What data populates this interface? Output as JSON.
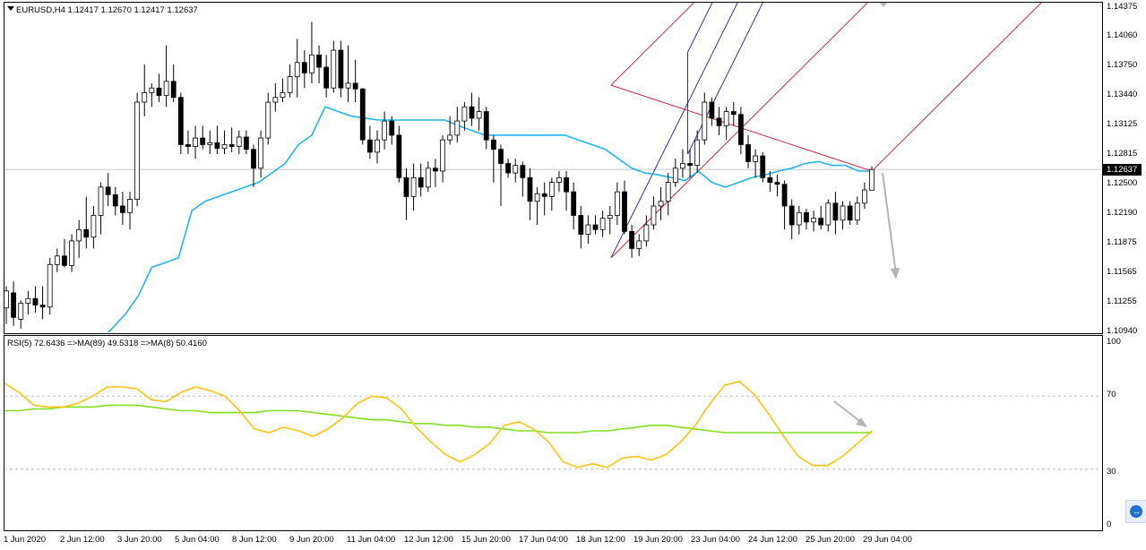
{
  "header": {
    "symbol_line": "EURUSD,H4  1.12417  1.12670  1.12417  1.12637",
    "rsi_line": "RSI(5) 72.6436  =>MA(89) 49.5318  =>MA(8) 50.4160"
  },
  "current_price": "1.12637",
  "price_axis_labels": [
    "1.14375",
    "1.14060",
    "1.13750",
    "1.13440",
    "1.13125",
    "1.12815",
    "1.12500",
    "1.12190",
    "1.11875",
    "1.11565",
    "1.11255",
    "1.10940"
  ],
  "rsi_axis_labels": [
    "100",
    "70",
    "30",
    "0"
  ],
  "time_axis_labels": [
    "1 Jun 2020",
    "2 Jun 12:00",
    "3 Jun 20:00",
    "5 Jun 04:00",
    "8 Jun 12:00",
    "9 Jun 20:00",
    "11 Jun 04:00",
    "12 Jun 12:00",
    "15 Jun 20:00",
    "17 Jun 04:00",
    "18 Jun 12:00",
    "19 Jun 20:00",
    "23 Jun 04:00",
    "24 Jun 12:00",
    "25 Jun 20:00",
    "29 Jun 04:00"
  ],
  "colors": {
    "bull_candle": "#ffffff",
    "bear_candle": "#000000",
    "envelope": "#1fb5f0",
    "pitchfork_up": "#1a1a9c",
    "pitchfork_down": "#c8102e",
    "rsi": "#ffc20e",
    "rsi_ma": "#7ee01e",
    "arrow": "#b4b4b4",
    "level_line": "#b4b4b4"
  },
  "chart_data": [
    {
      "type": "candlestick",
      "title": "EURUSD,H4",
      "ylim": [
        1.1094,
        1.14375
      ],
      "levels": {
        "last_price": 1.12637
      },
      "candles": [
        {
          "o": 1.1117,
          "h": 1.114,
          "l": 1.11,
          "c": 1.1135
        },
        {
          "o": 1.1133,
          "h": 1.1145,
          "l": 1.1098,
          "c": 1.1107
        },
        {
          "o": 1.1105,
          "h": 1.1125,
          "l": 1.1095,
          "c": 1.1122
        },
        {
          "o": 1.1122,
          "h": 1.1135,
          "l": 1.111,
          "c": 1.1127
        },
        {
          "o": 1.1127,
          "h": 1.114,
          "l": 1.1112,
          "c": 1.112
        },
        {
          "o": 1.112,
          "h": 1.114,
          "l": 1.1105,
          "c": 1.1118
        },
        {
          "o": 1.1118,
          "h": 1.117,
          "l": 1.111,
          "c": 1.1163
        },
        {
          "o": 1.1163,
          "h": 1.118,
          "l": 1.1155,
          "c": 1.1172
        },
        {
          "o": 1.1172,
          "h": 1.119,
          "l": 1.116,
          "c": 1.1162
        },
        {
          "o": 1.1162,
          "h": 1.1195,
          "l": 1.1155,
          "c": 1.1188
        },
        {
          "o": 1.1188,
          "h": 1.121,
          "l": 1.117,
          "c": 1.12
        },
        {
          "o": 1.12,
          "h": 1.1235,
          "l": 1.118,
          "c": 1.1192
        },
        {
          "o": 1.1192,
          "h": 1.1225,
          "l": 1.118,
          "c": 1.1215
        },
        {
          "o": 1.1215,
          "h": 1.125,
          "l": 1.1195,
          "c": 1.1245
        },
        {
          "o": 1.1245,
          "h": 1.126,
          "l": 1.1225,
          "c": 1.1237
        },
        {
          "o": 1.1237,
          "h": 1.1245,
          "l": 1.1215,
          "c": 1.1225
        },
        {
          "o": 1.1225,
          "h": 1.124,
          "l": 1.1205,
          "c": 1.1218
        },
        {
          "o": 1.1218,
          "h": 1.124,
          "l": 1.12,
          "c": 1.1232
        },
        {
          "o": 1.1232,
          "h": 1.1345,
          "l": 1.1225,
          "c": 1.1335
        },
        {
          "o": 1.1335,
          "h": 1.1375,
          "l": 1.132,
          "c": 1.1345
        },
        {
          "o": 1.1345,
          "h": 1.1355,
          "l": 1.133,
          "c": 1.135
        },
        {
          "o": 1.135,
          "h": 1.1365,
          "l": 1.1335,
          "c": 1.1342
        },
        {
          "o": 1.1342,
          "h": 1.1395,
          "l": 1.133,
          "c": 1.1357
        },
        {
          "o": 1.1357,
          "h": 1.1375,
          "l": 1.1335,
          "c": 1.134
        },
        {
          "o": 1.134,
          "h": 1.1345,
          "l": 1.128,
          "c": 1.129
        },
        {
          "o": 1.129,
          "h": 1.1305,
          "l": 1.128,
          "c": 1.1288
        },
        {
          "o": 1.1288,
          "h": 1.131,
          "l": 1.1275,
          "c": 1.1297
        },
        {
          "o": 1.1297,
          "h": 1.131,
          "l": 1.1285,
          "c": 1.129
        },
        {
          "o": 1.129,
          "h": 1.1305,
          "l": 1.128,
          "c": 1.1292
        },
        {
          "o": 1.1292,
          "h": 1.131,
          "l": 1.128,
          "c": 1.1286
        },
        {
          "o": 1.1286,
          "h": 1.1305,
          "l": 1.128,
          "c": 1.129
        },
        {
          "o": 1.129,
          "h": 1.1308,
          "l": 1.1282,
          "c": 1.1288
        },
        {
          "o": 1.1288,
          "h": 1.1305,
          "l": 1.128,
          "c": 1.1298
        },
        {
          "o": 1.1298,
          "h": 1.1305,
          "l": 1.128,
          "c": 1.1285
        },
        {
          "o": 1.1285,
          "h": 1.129,
          "l": 1.1245,
          "c": 1.1265
        },
        {
          "o": 1.1265,
          "h": 1.1305,
          "l": 1.1255,
          "c": 1.1297
        },
        {
          "o": 1.1297,
          "h": 1.1345,
          "l": 1.129,
          "c": 1.1335
        },
        {
          "o": 1.1335,
          "h": 1.1355,
          "l": 1.1325,
          "c": 1.134
        },
        {
          "o": 1.134,
          "h": 1.136,
          "l": 1.1335,
          "c": 1.1345
        },
        {
          "o": 1.1345,
          "h": 1.1375,
          "l": 1.134,
          "c": 1.1362
        },
        {
          "o": 1.1362,
          "h": 1.1402,
          "l": 1.134,
          "c": 1.1377
        },
        {
          "o": 1.1377,
          "h": 1.139,
          "l": 1.135,
          "c": 1.1366
        },
        {
          "o": 1.1366,
          "h": 1.142,
          "l": 1.1355,
          "c": 1.1385
        },
        {
          "o": 1.1385,
          "h": 1.1395,
          "l": 1.1355,
          "c": 1.1372
        },
        {
          "o": 1.1372,
          "h": 1.1385,
          "l": 1.134,
          "c": 1.135
        },
        {
          "o": 1.135,
          "h": 1.14,
          "l": 1.1345,
          "c": 1.139
        },
        {
          "o": 1.139,
          "h": 1.14,
          "l": 1.134,
          "c": 1.135
        },
        {
          "o": 1.135,
          "h": 1.1395,
          "l": 1.1335,
          "c": 1.1355
        },
        {
          "o": 1.1355,
          "h": 1.138,
          "l": 1.1335,
          "c": 1.1349
        },
        {
          "o": 1.1349,
          "h": 1.135,
          "l": 1.129,
          "c": 1.1295
        },
        {
          "o": 1.1295,
          "h": 1.131,
          "l": 1.1275,
          "c": 1.1282
        },
        {
          "o": 1.1282,
          "h": 1.1305,
          "l": 1.127,
          "c": 1.1295
        },
        {
          "o": 1.1295,
          "h": 1.1325,
          "l": 1.1285,
          "c": 1.1315
        },
        {
          "o": 1.1315,
          "h": 1.132,
          "l": 1.129,
          "c": 1.13
        },
        {
          "o": 1.13,
          "h": 1.131,
          "l": 1.125,
          "c": 1.1255
        },
        {
          "o": 1.1255,
          "h": 1.1265,
          "l": 1.121,
          "c": 1.1235
        },
        {
          "o": 1.1235,
          "h": 1.127,
          "l": 1.122,
          "c": 1.1255
        },
        {
          "o": 1.1255,
          "h": 1.127,
          "l": 1.1235,
          "c": 1.1245
        },
        {
          "o": 1.1245,
          "h": 1.1272,
          "l": 1.124,
          "c": 1.1265
        },
        {
          "o": 1.1265,
          "h": 1.1275,
          "l": 1.1245,
          "c": 1.1262
        },
        {
          "o": 1.1262,
          "h": 1.13,
          "l": 1.125,
          "c": 1.1295
        },
        {
          "o": 1.1295,
          "h": 1.132,
          "l": 1.129,
          "c": 1.13
        },
        {
          "o": 1.13,
          "h": 1.133,
          "l": 1.1292,
          "c": 1.1315
        },
        {
          "o": 1.1315,
          "h": 1.1335,
          "l": 1.1305,
          "c": 1.133
        },
        {
          "o": 1.133,
          "h": 1.1345,
          "l": 1.131,
          "c": 1.1318
        },
        {
          "o": 1.1318,
          "h": 1.134,
          "l": 1.1305,
          "c": 1.1325
        },
        {
          "o": 1.1325,
          "h": 1.133,
          "l": 1.1285,
          "c": 1.1295
        },
        {
          "o": 1.1295,
          "h": 1.13,
          "l": 1.125,
          "c": 1.1285
        },
        {
          "o": 1.1285,
          "h": 1.129,
          "l": 1.1225,
          "c": 1.127
        },
        {
          "o": 1.127,
          "h": 1.1275,
          "l": 1.1255,
          "c": 1.126
        },
        {
          "o": 1.126,
          "h": 1.1275,
          "l": 1.125,
          "c": 1.1268
        },
        {
          "o": 1.1268,
          "h": 1.1272,
          "l": 1.1235,
          "c": 1.1255
        },
        {
          "o": 1.1255,
          "h": 1.1265,
          "l": 1.121,
          "c": 1.123
        },
        {
          "o": 1.123,
          "h": 1.1245,
          "l": 1.1205,
          "c": 1.1238
        },
        {
          "o": 1.1238,
          "h": 1.125,
          "l": 1.1215,
          "c": 1.1235
        },
        {
          "o": 1.1235,
          "h": 1.1255,
          "l": 1.122,
          "c": 1.125
        },
        {
          "o": 1.125,
          "h": 1.1262,
          "l": 1.124,
          "c": 1.1255
        },
        {
          "o": 1.1255,
          "h": 1.1262,
          "l": 1.122,
          "c": 1.124
        },
        {
          "o": 1.124,
          "h": 1.125,
          "l": 1.12,
          "c": 1.1215
        },
        {
          "o": 1.1215,
          "h": 1.1225,
          "l": 1.118,
          "c": 1.1195
        },
        {
          "o": 1.1195,
          "h": 1.1215,
          "l": 1.1185,
          "c": 1.1205
        },
        {
          "o": 1.1205,
          "h": 1.1215,
          "l": 1.1195,
          "c": 1.12
        },
        {
          "o": 1.12,
          "h": 1.122,
          "l": 1.1192,
          "c": 1.1212
        },
        {
          "o": 1.1212,
          "h": 1.1225,
          "l": 1.1195,
          "c": 1.1215
        },
        {
          "o": 1.1215,
          "h": 1.125,
          "l": 1.1205,
          "c": 1.124
        },
        {
          "o": 1.124,
          "h": 1.1252,
          "l": 1.1195,
          "c": 1.1198
        },
        {
          "o": 1.1198,
          "h": 1.1205,
          "l": 1.117,
          "c": 1.118
        },
        {
          "o": 1.118,
          "h": 1.1195,
          "l": 1.1172,
          "c": 1.1188
        },
        {
          "o": 1.1188,
          "h": 1.1215,
          "l": 1.1182,
          "c": 1.1205
        },
        {
          "o": 1.1205,
          "h": 1.1235,
          "l": 1.12,
          "c": 1.1225
        },
        {
          "o": 1.1225,
          "h": 1.1245,
          "l": 1.121,
          "c": 1.123
        },
        {
          "o": 1.123,
          "h": 1.126,
          "l": 1.1215,
          "c": 1.125
        },
        {
          "o": 1.125,
          "h": 1.1275,
          "l": 1.1245,
          "c": 1.1265
        },
        {
          "o": 1.1265,
          "h": 1.1285,
          "l": 1.1255,
          "c": 1.127
        },
        {
          "o": 1.127,
          "h": 1.1285,
          "l": 1.1255,
          "c": 1.1268
        },
        {
          "o": 1.1268,
          "h": 1.1305,
          "l": 1.126,
          "c": 1.1295
        },
        {
          "o": 1.1295,
          "h": 1.1345,
          "l": 1.129,
          "c": 1.1335
        },
        {
          "o": 1.1335,
          "h": 1.134,
          "l": 1.131,
          "c": 1.1318
        },
        {
          "o": 1.1318,
          "h": 1.133,
          "l": 1.13,
          "c": 1.131
        },
        {
          "o": 1.131,
          "h": 1.133,
          "l": 1.1295,
          "c": 1.1325
        },
        {
          "o": 1.1325,
          "h": 1.1335,
          "l": 1.131,
          "c": 1.1322
        },
        {
          "o": 1.1322,
          "h": 1.133,
          "l": 1.128,
          "c": 1.129
        },
        {
          "o": 1.129,
          "h": 1.13,
          "l": 1.1265,
          "c": 1.1272
        },
        {
          "o": 1.1272,
          "h": 1.1285,
          "l": 1.1255,
          "c": 1.1278
        },
        {
          "o": 1.1278,
          "h": 1.1282,
          "l": 1.125,
          "c": 1.1255
        },
        {
          "o": 1.1255,
          "h": 1.1262,
          "l": 1.124,
          "c": 1.125
        },
        {
          "o": 1.125,
          "h": 1.1258,
          "l": 1.1235,
          "c": 1.1248
        },
        {
          "o": 1.1248,
          "h": 1.1252,
          "l": 1.12,
          "c": 1.1225
        },
        {
          "o": 1.1225,
          "h": 1.1232,
          "l": 1.119,
          "c": 1.1205
        },
        {
          "o": 1.1205,
          "h": 1.1225,
          "l": 1.1195,
          "c": 1.1218
        },
        {
          "o": 1.1218,
          "h": 1.1222,
          "l": 1.12,
          "c": 1.1208
        },
        {
          "o": 1.1208,
          "h": 1.122,
          "l": 1.1198,
          "c": 1.1212
        },
        {
          "o": 1.1212,
          "h": 1.1225,
          "l": 1.12,
          "c": 1.1205
        },
        {
          "o": 1.1205,
          "h": 1.1232,
          "l": 1.1198,
          "c": 1.1228
        },
        {
          "o": 1.1228,
          "h": 1.124,
          "l": 1.1195,
          "c": 1.121
        },
        {
          "o": 1.121,
          "h": 1.123,
          "l": 1.12,
          "c": 1.1225
        },
        {
          "o": 1.1225,
          "h": 1.123,
          "l": 1.1205,
          "c": 1.121
        },
        {
          "o": 1.121,
          "h": 1.1235,
          "l": 1.1205,
          "c": 1.1228
        },
        {
          "o": 1.1228,
          "h": 1.125,
          "l": 1.1222,
          "c": 1.1242
        },
        {
          "o": 1.12417,
          "h": 1.1267,
          "l": 1.12417,
          "c": 1.12637
        }
      ],
      "envelope_line": [
        1.107,
        1.108,
        1.1095,
        1.111,
        1.113,
        1.116,
        1.1165,
        1.117,
        1.122,
        1.123,
        1.1235,
        1.124,
        1.1245,
        1.125,
        1.126,
        1.127,
        1.129,
        1.13,
        1.133,
        1.1325,
        1.132,
        1.1318,
        1.1316,
        1.1316,
        1.1316,
        1.1316,
        1.1316,
        1.1316,
        1.131,
        1.1305,
        1.13,
        1.13,
        1.13,
        1.13,
        1.13,
        1.13,
        1.13,
        1.1295,
        1.129,
        1.1285,
        1.1275,
        1.1265,
        1.126,
        1.1258,
        1.1255,
        1.1252,
        1.1262,
        1.125,
        1.1245,
        1.125,
        1.1255,
        1.1258,
        1.1262,
        1.1265,
        1.127,
        1.1272,
        1.1268,
        1.1268,
        1.1262,
        1.1262
      ],
      "pitchforks": [
        {
          "color": "up",
          "points": [
            [
              0.553,
              1.117
            ],
            [
              0.623,
              1.128
            ],
            [
              0.623,
              1.1388
            ]
          ]
        },
        {
          "color": "down",
          "points": [
            [
              0.553,
              1.117
            ],
            [
              0.553,
              1.1353
            ],
            [
              0.791,
              1.1262
            ]
          ]
        }
      ]
    },
    {
      "type": "line",
      "title": "RSI(5) 72.6436  =>MA(89) 49.5318  =>MA(8) 50.4160",
      "ylim": [
        0,
        100
      ],
      "levels": [
        70,
        30
      ],
      "series": [
        {
          "name": "RSI(5)",
          "values": [
            77,
            72,
            65,
            64,
            64,
            66,
            70,
            75,
            75,
            74,
            68,
            67,
            72,
            75,
            73,
            70,
            62,
            52,
            50,
            53,
            51,
            48,
            52,
            58,
            66,
            70,
            69,
            63,
            53,
            45,
            38,
            34,
            38,
            44,
            54,
            56,
            52,
            45,
            34,
            31,
            33,
            31,
            36,
            37,
            35,
            38,
            45,
            54,
            66,
            76,
            78,
            71,
            60,
            48,
            37,
            32,
            32,
            37,
            44,
            51
          ]
        },
        {
          "name": "MA(89)",
          "values": [
            62,
            62,
            63,
            63,
            64,
            64,
            64,
            65,
            65,
            65,
            64,
            63,
            62,
            62,
            61,
            61,
            61,
            61,
            62,
            62,
            62,
            61,
            60,
            59,
            58,
            57,
            57,
            56,
            55,
            55,
            54,
            54,
            53,
            53,
            52,
            51,
            51,
            50,
            50,
            50,
            51,
            51,
            52,
            53,
            54,
            54,
            53,
            52,
            51,
            50,
            50,
            50,
            50,
            50,
            50,
            50,
            50,
            50,
            50,
            50
          ]
        }
      ]
    }
  ]
}
